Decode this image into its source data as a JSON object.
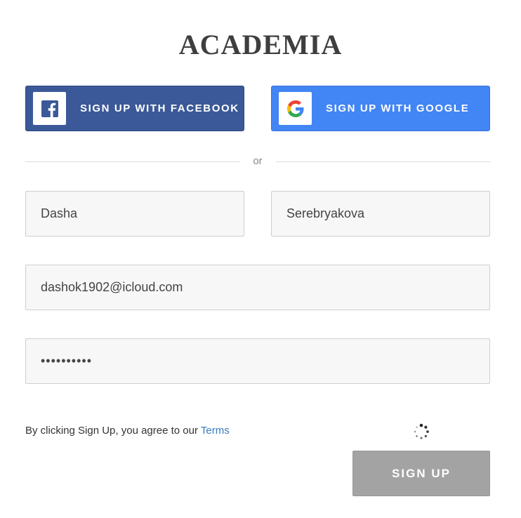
{
  "brand": {
    "logo_text": "ACADEMIA"
  },
  "social": {
    "facebook": {
      "label": "SIGN UP WITH FACEBOOK",
      "icon": "facebook-icon",
      "color": "#3b5998"
    },
    "google": {
      "label": "SIGN UP WITH GOOGLE",
      "icon": "google-icon",
      "color": "#4285f4"
    }
  },
  "divider": {
    "text": "or"
  },
  "form": {
    "first_name": {
      "value": "Dasha"
    },
    "last_name": {
      "value": "Serebryakova"
    },
    "email": {
      "value": "dashok1902@icloud.com"
    },
    "password": {
      "value": "••••••••••"
    }
  },
  "terms": {
    "prefix": "By clicking Sign Up, you agree to our",
    "link": "Terms"
  },
  "status": {
    "icon": "loading-spinner-icon"
  },
  "submit": {
    "label": "SIGN UP",
    "color": "#a3a3a3"
  }
}
